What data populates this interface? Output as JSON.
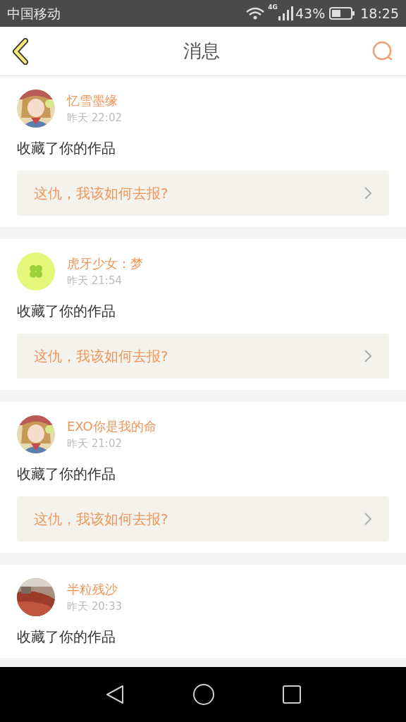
{
  "status_bar": {
    "carrier": "中国移动",
    "network": "4G",
    "battery": "43%",
    "time": "18:25"
  },
  "header": {
    "title": "消息"
  },
  "messages": [
    {
      "name": "忆雪墨缘",
      "time": "昨天 22:02",
      "action": "收藏了你的作品",
      "quote": "这仇，我该如何去报?"
    },
    {
      "avatar": {
        "kind": "clover"
      },
      "name": "虎牙少女：梦",
      "time": "昨天 21:54",
      "action": "收藏了你的作品",
      "quote": "这仇，我该如何去报?"
    },
    {
      "name": "EXO你是我的命",
      "time": "昨天 21:02",
      "action": "收藏了你的作品",
      "quote": "这仇，我该如何去报?"
    },
    {
      "name": "半粒残沙",
      "time": "昨天 20:33",
      "action": "收藏了你的作品"
    }
  ]
}
